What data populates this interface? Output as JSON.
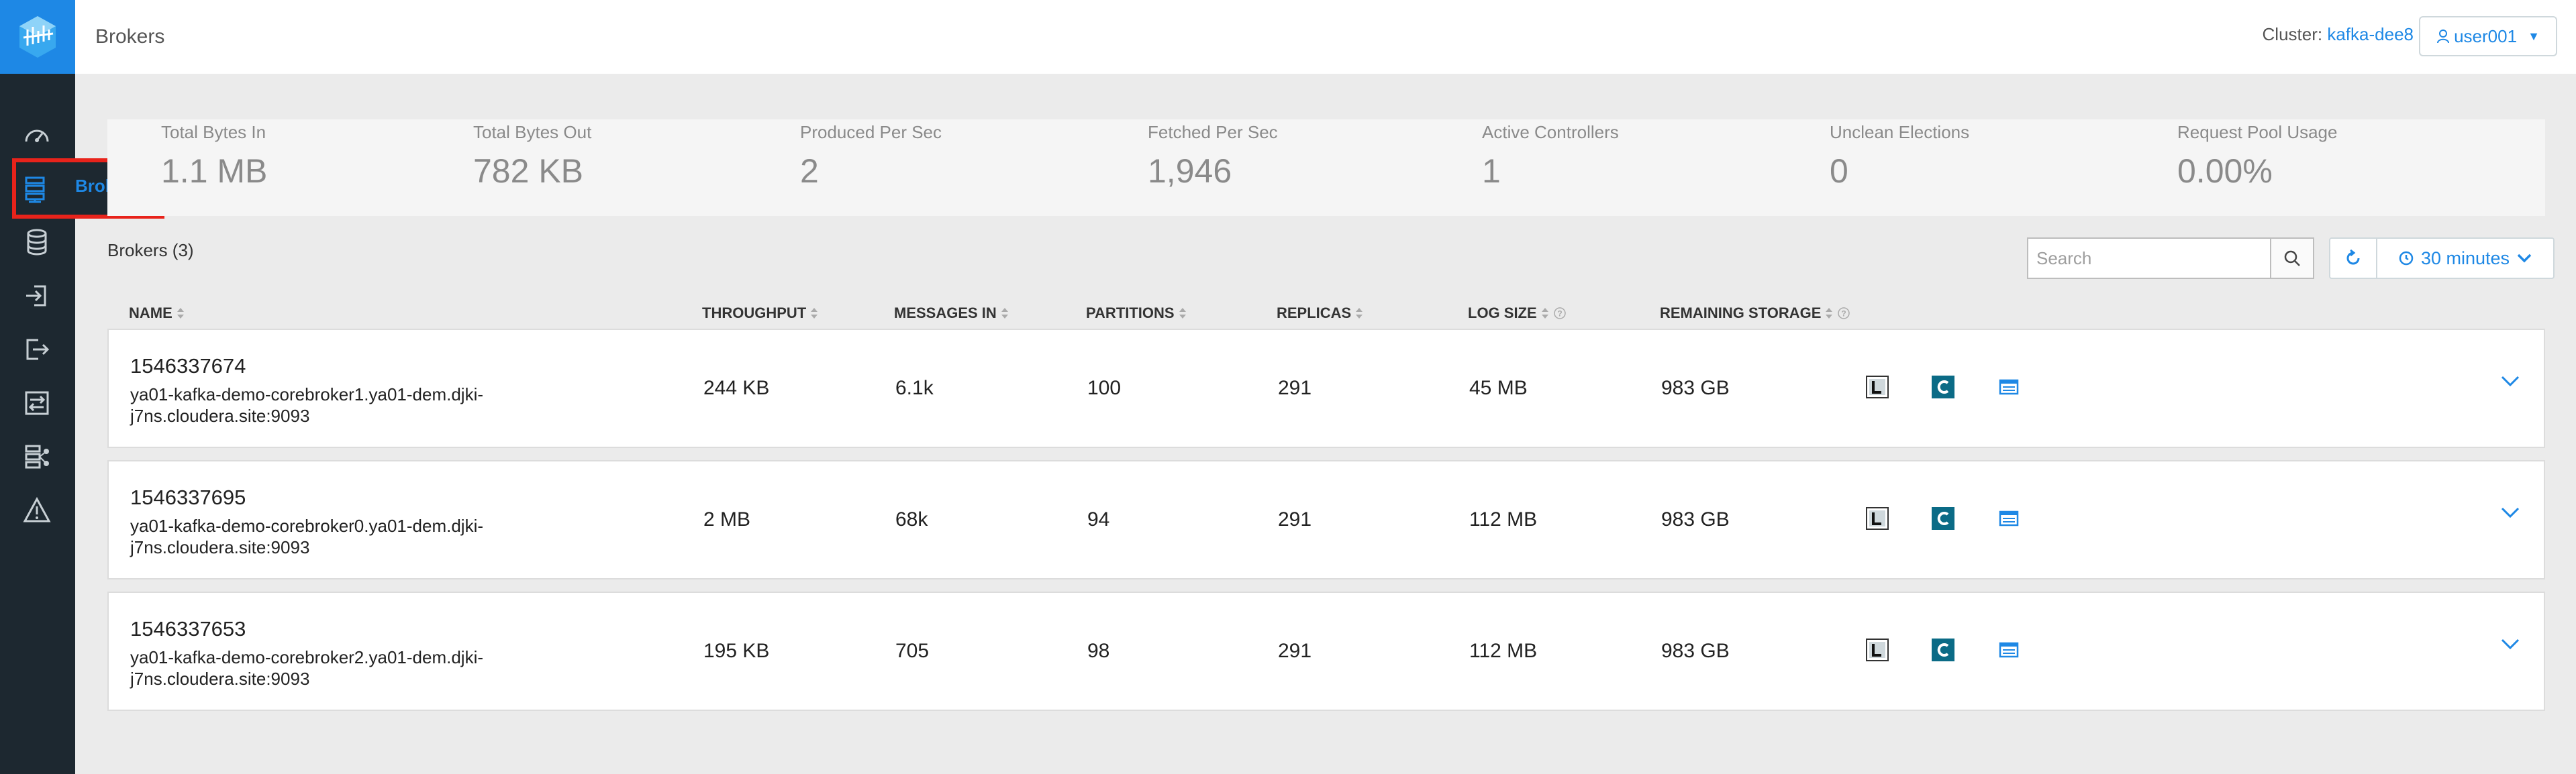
{
  "header": {
    "title": "Brokers",
    "cluster_label": "Cluster:",
    "cluster_name": "kafka-dee8",
    "user": "user001"
  },
  "sidebar": {
    "active_item": "Brokers",
    "items": [
      "dashboard-icon",
      "brokers-icon",
      "topics-icon",
      "producers-icon",
      "consumers-icon",
      "replication-icon",
      "topology-icon",
      "alerts-icon"
    ]
  },
  "stats": [
    {
      "label": "Total Bytes In",
      "value": "1.1 MB"
    },
    {
      "label": "Total Bytes Out",
      "value": "782 KB"
    },
    {
      "label": "Produced Per Sec",
      "value": "2"
    },
    {
      "label": "Fetched Per Sec",
      "value": "1,946"
    },
    {
      "label": "Active Controllers",
      "value": "1"
    },
    {
      "label": "Unclean Elections",
      "value": "0"
    },
    {
      "label": "Request Pool Usage",
      "value": "0.00%"
    }
  ],
  "brokers": {
    "title": "Brokers (3)",
    "search_placeholder": "Search",
    "time_range": "30 minutes",
    "columns": [
      "NAME",
      "THROUGHPUT",
      "MESSAGES IN",
      "PARTITIONS",
      "REPLICAS",
      "LOG SIZE",
      "REMAINING STORAGE"
    ],
    "rows": [
      {
        "id": "1546337674",
        "host": "ya01-kafka-demo-corebroker1.ya01-dem.djki-j7ns.cloudera.site:9093",
        "throughput": "244 KB",
        "messages_in": "6.1k",
        "partitions": "100",
        "replicas": "291",
        "log_size": "45 MB",
        "remaining_storage": "983 GB"
      },
      {
        "id": "1546337695",
        "host": "ya01-kafka-demo-corebroker0.ya01-dem.djki-j7ns.cloudera.site:9093",
        "throughput": "2 MB",
        "messages_in": "68k",
        "partitions": "94",
        "replicas": "291",
        "log_size": "112 MB",
        "remaining_storage": "983 GB"
      },
      {
        "id": "1546337653",
        "host": "ya01-kafka-demo-corebroker2.ya01-dem.djki-j7ns.cloudera.site:9093",
        "throughput": "195 KB",
        "messages_in": "705",
        "partitions": "98",
        "replicas": "291",
        "log_size": "112 MB",
        "remaining_storage": "983 GB"
      }
    ]
  },
  "colors": {
    "accent": "#1e88e5",
    "sidebar": "#1d2830",
    "highlight": "#e8231b",
    "teal_icon": "#0b6b86"
  }
}
